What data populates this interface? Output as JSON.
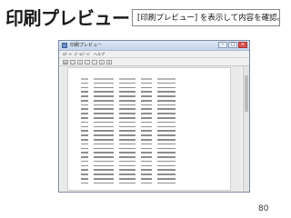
{
  "slide": {
    "title": "印刷プレビュー",
    "callout": "[印刷プレビュー] を表示して内容を確認。",
    "page_number": "80"
  },
  "window": {
    "title": "印刷プレビュー",
    "menu": [
      "ｴﾎﾟｰﾄ",
      "ｽﾞｰﾑﾍﾟｰｼﾞ",
      "ヘルプ"
    ],
    "toolbar_icons": [
      "print-icon",
      "zoom-icon",
      "first-page-icon",
      "prev-page-icon",
      "next-page-icon",
      "last-page-icon",
      "close-icon"
    ]
  }
}
